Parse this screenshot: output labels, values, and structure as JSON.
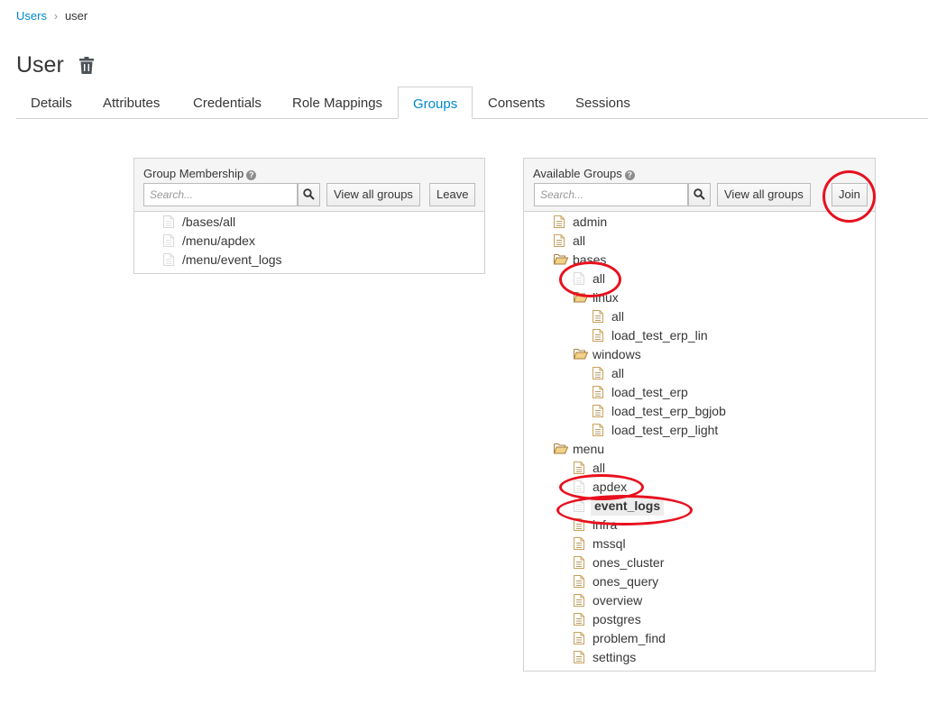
{
  "breadcrumb": {
    "parent": "Users",
    "current": "user"
  },
  "page": {
    "title": "User"
  },
  "tabs": [
    {
      "label": "Details"
    },
    {
      "label": "Attributes"
    },
    {
      "label": "Credentials"
    },
    {
      "label": "Role Mappings"
    },
    {
      "label": "Groups",
      "active": true
    },
    {
      "label": "Consents"
    },
    {
      "label": "Sessions"
    }
  ],
  "membership": {
    "title": "Group Membership",
    "search_placeholder": "Search...",
    "view_all_label": "View all groups",
    "leave_label": "Leave",
    "items": [
      "/bases/all",
      "/menu/apdex",
      "/menu/event_logs"
    ]
  },
  "available": {
    "title": "Available Groups",
    "search_placeholder": "Search...",
    "view_all_label": "View all groups",
    "join_label": "Join",
    "tree": [
      "admin",
      "all",
      "bases",
      "all",
      "linux",
      "all",
      "load_test_erp_lin",
      "windows",
      "all",
      "load_test_erp",
      "load_test_erp_bgjob",
      "load_test_erp_light",
      "menu",
      "all",
      "apdex",
      "event_logs",
      "infra",
      "mssql",
      "ones_cluster",
      "ones_query",
      "overview",
      "postgres",
      "problem_find",
      "settings"
    ]
  },
  "colors": {
    "accent": "#0088ce",
    "annotation": "#e8101e",
    "folder": "#c9a15a"
  }
}
